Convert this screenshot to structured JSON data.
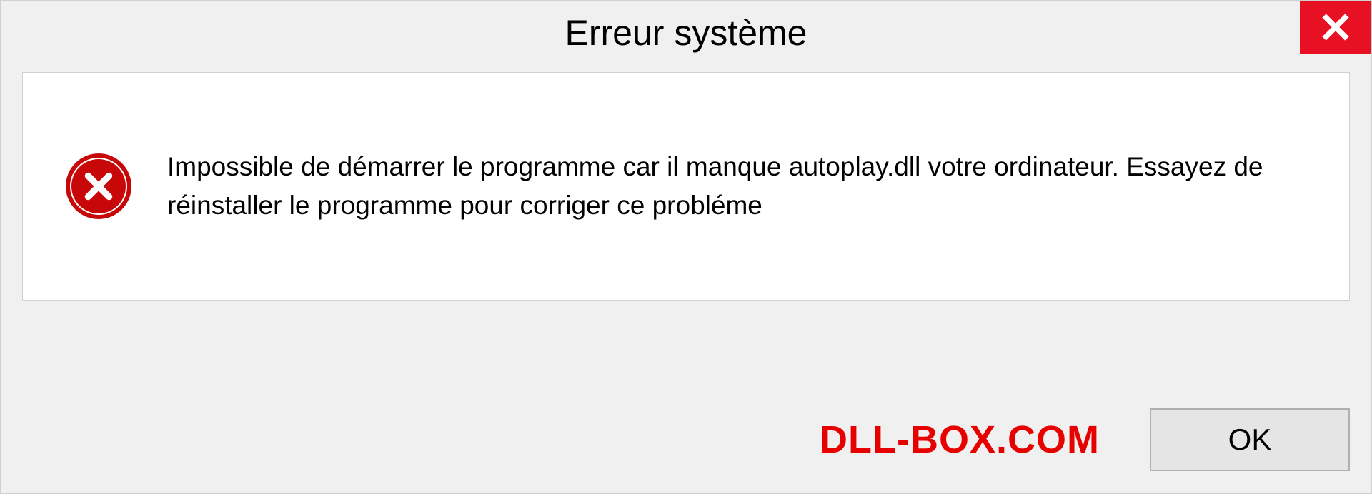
{
  "dialog": {
    "title": "Erreur système",
    "message": "Impossible de démarrer le programme car il manque autoplay.dll votre ordinateur. Essayez de réinstaller le programme pour corriger ce probléme",
    "ok_label": "OK"
  },
  "watermark": "DLL-BOX.COM"
}
